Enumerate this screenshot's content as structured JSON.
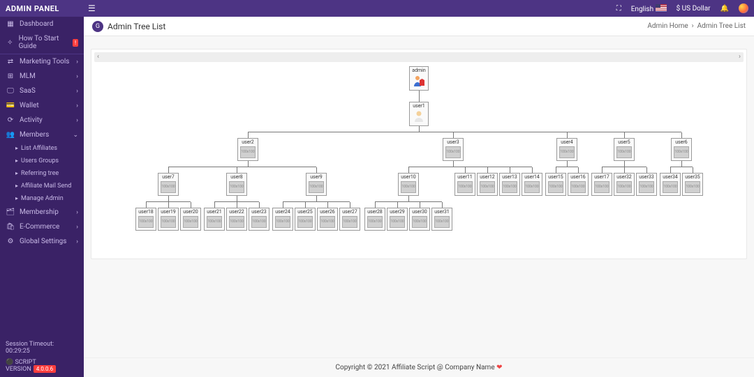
{
  "brand": "ADMIN PANEL",
  "lang": "English",
  "currency": "$ US Dollar",
  "sidebar": {
    "dashboard": "Dashboard",
    "howto": "How To Start Guide",
    "howto_badge": "!",
    "marketing": "Marketing Tools",
    "mlm": "MLM",
    "saas": "SaaS",
    "wallet": "Wallet",
    "activity": "Activity",
    "members": "Members",
    "sub": {
      "list_affiliates": "List Affiliates",
      "users_groups": "Users Groups",
      "referring": "Referring tree",
      "mail_send": "Affiliate Mail Send",
      "manage_admin": "Manage Admin"
    },
    "membership": "Membership",
    "ecommerce": "E-Commerce",
    "global": "Global Settings",
    "timeout": "Session Timeout: 00:29:25",
    "version_label": "SCRIPT VERSION",
    "version": "4.0.0.6"
  },
  "page": {
    "title": "Admin Tree List",
    "crumb_home": "Admin Home",
    "crumb_here": "Admin Tree List"
  },
  "tree": {
    "root": "admin",
    "l1": "user1",
    "l2": [
      "user2",
      "user3",
      "user4",
      "user5",
      "user6"
    ],
    "u2c": [
      "user7",
      "user8",
      "user9"
    ],
    "u3c": [
      "user10",
      "user11",
      "user12",
      "user13",
      "user14"
    ],
    "u4c": [
      "user15",
      "user16"
    ],
    "u5c": [
      "user17",
      "user32",
      "user33"
    ],
    "u6c": [
      "user34",
      "user35"
    ],
    "u7c": [
      "user18",
      "user19",
      "user20"
    ],
    "u8c": [
      "user21",
      "user22",
      "user23"
    ],
    "u9c": [
      "user24",
      "user25",
      "user26",
      "user27"
    ],
    "u10c": [
      "user28",
      "user29",
      "user30",
      "user31"
    ]
  },
  "footer": "Copyright © 2021 Affiliate Script @ Company Name "
}
